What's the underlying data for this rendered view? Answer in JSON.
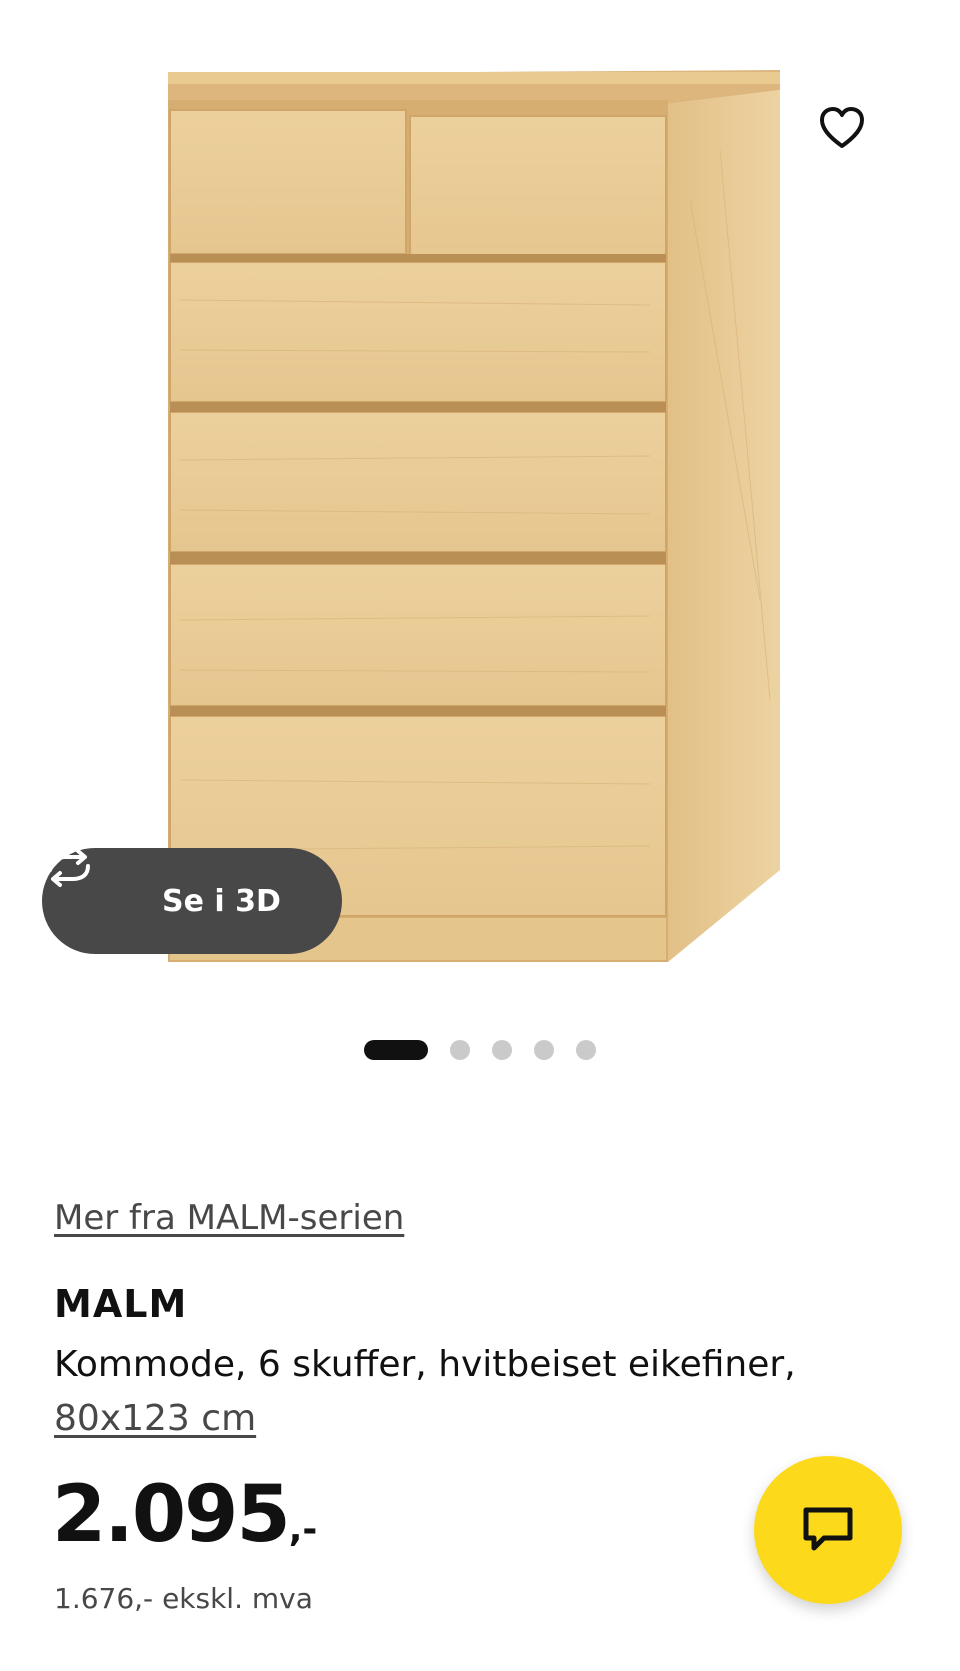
{
  "gallery": {
    "view_3d_label": "Se i 3D",
    "view_3d_icon": "rotate-3d-icon",
    "favorite_icon": "heart-icon",
    "dots": [
      {
        "active": true
      },
      {
        "active": false
      },
      {
        "active": false
      },
      {
        "active": false
      },
      {
        "active": false
      }
    ]
  },
  "product": {
    "series_link": "Mer fra MALM-serien",
    "name": "MALM",
    "description": "Kommode, 6 skuffer, hvitbeiset eikefiner,",
    "measurement": "80x123 cm",
    "price_amount": "2.095",
    "price_suffix": ",-",
    "price_ex_vat": "1.676,- ekskl. mva"
  },
  "chat": {
    "icon": "chat-bubble-icon",
    "color": "#fcd91b"
  },
  "colors": {
    "wood_light": "#e8c994",
    "wood_mid": "#dcb77e",
    "wood_dark": "#c99e60",
    "pill_bg": "#484848"
  }
}
